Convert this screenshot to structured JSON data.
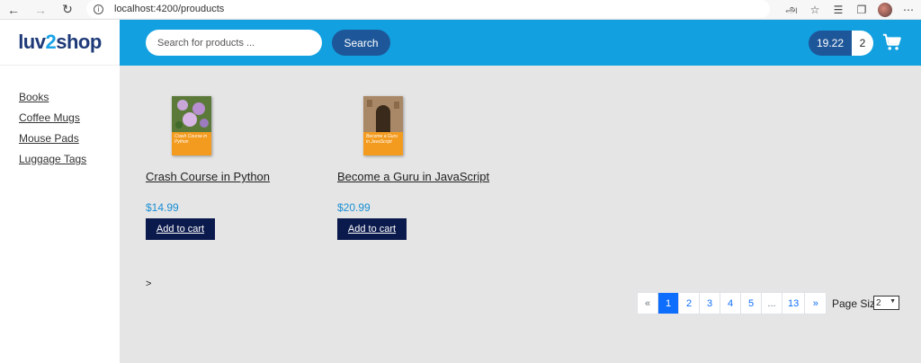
{
  "browser": {
    "url": "localhost:4200/prouducts"
  },
  "brand": {
    "logo_prefix": "luv",
    "logo_two": "2",
    "logo_suffix": "shop"
  },
  "sidebar": {
    "items": [
      {
        "label": "Books"
      },
      {
        "label": "Coffee Mugs"
      },
      {
        "label": "Mouse Pads"
      },
      {
        "label": "Luggage Tags"
      }
    ]
  },
  "header": {
    "search_placeholder": "Search for products ...",
    "search_button": "Search",
    "cart_total": "19.22",
    "cart_quantity": "2"
  },
  "products": [
    {
      "title": "Crash Course in Python",
      "cover_title": "Crash Course in Python",
      "price": "$14.99",
      "add_label": "Add to cart"
    },
    {
      "title": "Become a Guru in JavaScript",
      "cover_title": "Become a Guru in JavaScript",
      "price": "$20.99",
      "add_label": "Add to cart"
    }
  ],
  "next_text": ">",
  "pagination": {
    "items": [
      "«",
      "1",
      "2",
      "3",
      "4",
      "5",
      "...",
      "13",
      "»"
    ],
    "active": "1"
  },
  "page_size": {
    "label": "Page Size",
    "selected": "2"
  },
  "colors": {
    "header": "#12a0e0",
    "button_dark": "#1e5799",
    "add_button": "#0b1a4d",
    "price": "#1a8fd4",
    "active_page": "#0d6efd"
  }
}
